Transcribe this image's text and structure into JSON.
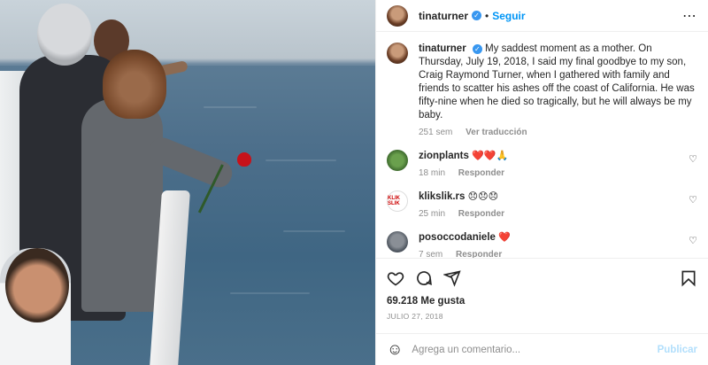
{
  "header": {
    "username": "tinaturner",
    "verified_mark": "✓",
    "separator": "•",
    "follow_label": "Seguir",
    "more_icon": "⋯"
  },
  "caption": {
    "username": "tinaturner",
    "verified_mark": "✓",
    "text": "My saddest moment as a mother. On Thursday, July 19, 2018, I said my final goodbye to my son, Craig Raymond Turner, when I gathered with family and friends to scatter his ashes off the coast of California. He was fifty-nine when he died so tragically, but he will always be my baby.",
    "time": "251 sem",
    "translate_label": "Ver traducción"
  },
  "comments": [
    {
      "username": "zionplants",
      "text": "❤️❤️🙏",
      "time": "18 min",
      "reply_label": "Responder",
      "avatar_text": ""
    },
    {
      "username": "klikslik.rs",
      "text": "😞😞😞",
      "time": "25 min",
      "reply_label": "Responder",
      "avatar_text": "KLIK SLIK"
    },
    {
      "username": "posoccodaniele",
      "text": "❤️",
      "time": "7 sem",
      "reply_label": "Responder",
      "avatar_text": ""
    }
  ],
  "actions": {
    "likes": "69.218 Me gusta",
    "date": "JULIO 27, 2018"
  },
  "add_comment": {
    "placeholder": "Agrega un comentario...",
    "post_label": "Publicar",
    "emoji_icon": "☺"
  },
  "colors": {
    "accent": "#0095f6",
    "verified": "#3897f0",
    "muted": "#8e8e8e",
    "post_disabled": "#b2dffc"
  }
}
